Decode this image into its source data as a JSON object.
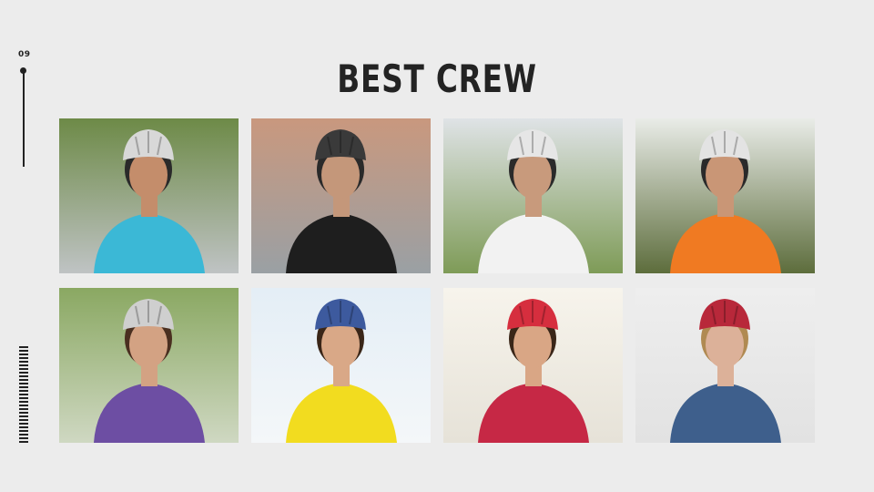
{
  "slide": {
    "number": "09"
  },
  "title": "BEST CREW",
  "photos": [
    {
      "subject": "cyclist-teal-jersey",
      "bg_top": "#6d8a47",
      "bg_bottom": "#bfc3c4",
      "shirt": "#3bb8d6",
      "helmet": "#d8d8d8",
      "skin": "#c48d6b",
      "hair": "#2a2a2a"
    },
    {
      "subject": "cyclist-black-red-jersey",
      "bg_top": "#c9987e",
      "bg_bottom": "#9aa0a4",
      "shirt": "#1e1e1e",
      "helmet": "#3a3a3a",
      "skin": "#c4977a",
      "hair": "#2a2a2a"
    },
    {
      "subject": "cyclist-white-black-jersey",
      "bg_top": "#dfe3e6",
      "bg_bottom": "#7e9b57",
      "shirt": "#f2f2f2",
      "helmet": "#e6e6e6",
      "skin": "#c89a7c",
      "hair": "#2a2a2a"
    },
    {
      "subject": "cyclist-orange-jacket",
      "bg_top": "#e9ece8",
      "bg_bottom": "#5d6d3c",
      "shirt": "#f07a22",
      "helmet": "#e3e3e3",
      "skin": "#c99676",
      "hair": "#2a2a2a"
    },
    {
      "subject": "woman-purple-top",
      "bg_top": "#8aa862",
      "bg_bottom": "#cfd8c2",
      "shirt": "#6d4ea3",
      "helmet": "#cfcfcf",
      "skin": "#d3a283",
      "hair": "#4a2f20"
    },
    {
      "subject": "woman-yellow-top",
      "bg_top": "#e4eef6",
      "bg_bottom": "#f4f7f9",
      "shirt": "#f2dc1f",
      "helmet": "#3d5a9e",
      "skin": "#d9a887",
      "hair": "#3a2618"
    },
    {
      "subject": "woman-red-helmet-smiling",
      "bg_top": "#f7f4ec",
      "bg_bottom": "#e6e2d8",
      "shirt": "#c62845",
      "helmet": "#d62e3e",
      "skin": "#d9a685",
      "hair": "#3a2618"
    },
    {
      "subject": "woman-denim-jacket",
      "bg_top": "#eeeeee",
      "bg_bottom": "#e2e2e2",
      "shirt": "#3e5f8c",
      "helmet": "#b8283a",
      "skin": "#dcb199",
      "hair": "#b08a52"
    }
  ]
}
